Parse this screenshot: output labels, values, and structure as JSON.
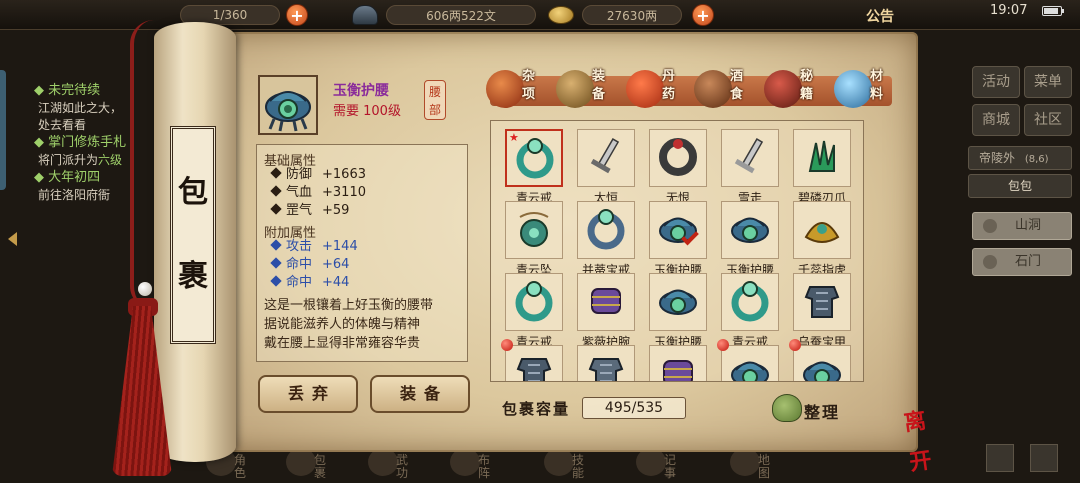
{
  "topbar": {
    "stamina": "1/360",
    "silver": "606两522文",
    "gold": "27630两",
    "notice": "公告",
    "time": "19:07"
  },
  "quests": [
    {
      "title": "未完待续",
      "lines": [
        "江湖如此之大，",
        "处去看看"
      ]
    },
    {
      "title": "掌门修炼手札",
      "lines": [
        "将门派升为",
        "前往洛阳府衙"
      ],
      "highlight": "六级"
    },
    {
      "title": "大年初四",
      "lines": []
    }
  ],
  "side": {
    "buttons": [
      "活动",
      "菜单",
      "商城",
      "社区"
    ],
    "location": "帝陵外",
    "coords": "(8,6)",
    "bag_tab": "包包",
    "scenes": [
      "山洞",
      "石门"
    ]
  },
  "scroll": {
    "title_chars": [
      "包",
      "裹"
    ]
  },
  "item": {
    "name": "玉衡护腰",
    "requirement": "需要 100级",
    "slot": [
      "腰",
      "部"
    ],
    "base_header": "基础属性",
    "base": [
      {
        "label": "防御",
        "value": "+1663"
      },
      {
        "label": "气血",
        "value": "+3110"
      },
      {
        "label": "罡气",
        "value": "+59"
      }
    ],
    "extra_header": "附加属性",
    "extra": [
      {
        "label": "攻击",
        "value": "+144"
      },
      {
        "label": "命中",
        "value": "+64"
      },
      {
        "label": "命中",
        "value": "+44"
      }
    ],
    "description": [
      "这是一根镶着上好玉衡的腰带",
      "据说能滋养人的体魄与精神",
      "戴在腰上显得非常雍容华贵"
    ]
  },
  "actions": {
    "discard": "丢弃",
    "equip": "装备"
  },
  "tabs": [
    {
      "label": "杂项",
      "icon": "pot-icon",
      "color": "#b8502a"
    },
    {
      "label": "装备",
      "icon": "weapon-icon",
      "color": "#8a6a3a"
    },
    {
      "label": "丹药",
      "icon": "pill-icon",
      "color": "#c8401c"
    },
    {
      "label": "酒食",
      "icon": "jar-icon",
      "color": "#7a4a2a"
    },
    {
      "label": "秘籍",
      "icon": "book-icon",
      "color": "#8a2a2a"
    },
    {
      "label": "材料",
      "icon": "crystal-icon",
      "color": "#4a8ab8"
    }
  ],
  "inventory": {
    "items": [
      {
        "name": "青云戒",
        "icon": "ring-icon",
        "color": "#2f9a8a",
        "selected": true,
        "star": true
      },
      {
        "name": "太恒",
        "icon": "sword-icon",
        "color": "#6a6a6a"
      },
      {
        "name": "无恨",
        "icon": "bracelet-icon",
        "color": "#3a3a3a"
      },
      {
        "name": "雪走",
        "icon": "blade-icon",
        "color": "#9a9a9a"
      },
      {
        "name": "碧磷刃爪",
        "icon": "claw-icon",
        "color": "#2a9a5a"
      },
      {
        "name": "青云坠",
        "icon": "pendant-icon",
        "color": "#3a8a7a"
      },
      {
        "name": "并蒂宝戒",
        "icon": "ring-icon",
        "color": "#4a6a8a"
      },
      {
        "name": "玉衡护腰",
        "icon": "belt-icon",
        "color": "#3a6a8a",
        "equipped": true
      },
      {
        "name": "玉衡护腰",
        "icon": "belt-icon",
        "color": "#3a6a8a"
      },
      {
        "name": "千蕊指虎",
        "icon": "knuckle-icon",
        "color": "#c89a2a"
      },
      {
        "name": "青云戒",
        "icon": "ring-icon",
        "color": "#2f9a8a"
      },
      {
        "name": "紫薇护腕",
        "icon": "bracer-icon",
        "color": "#6a4a9a"
      },
      {
        "name": "玉衡护腰",
        "icon": "belt-icon",
        "color": "#3a6a8a"
      },
      {
        "name": "青云戒",
        "icon": "ring-icon",
        "color": "#2f9a8a"
      },
      {
        "name": "乌蚕宝甲",
        "icon": "armor-icon",
        "color": "#4a5a6a"
      },
      {
        "name": "",
        "icon": "armor-icon",
        "color": "#4a5a6a",
        "reddot": true
      },
      {
        "name": "",
        "icon": "armor-icon",
        "color": "#5a6a7a"
      },
      {
        "name": "",
        "icon": "bracer-icon",
        "color": "#6a4a9a"
      },
      {
        "name": "",
        "icon": "belt-icon",
        "color": "#3a6a8a",
        "reddot": true
      },
      {
        "name": "",
        "icon": "belt-icon",
        "color": "#3a6a8a",
        "reddot": true
      }
    ],
    "capacity_label": "包裹容量",
    "capacity": "495/535",
    "sort_label": "整理"
  },
  "bottom_menu": [
    "角色",
    "包裹",
    "武功",
    "布阵",
    "技能",
    "记事",
    "地图"
  ],
  "seal": "离开"
}
